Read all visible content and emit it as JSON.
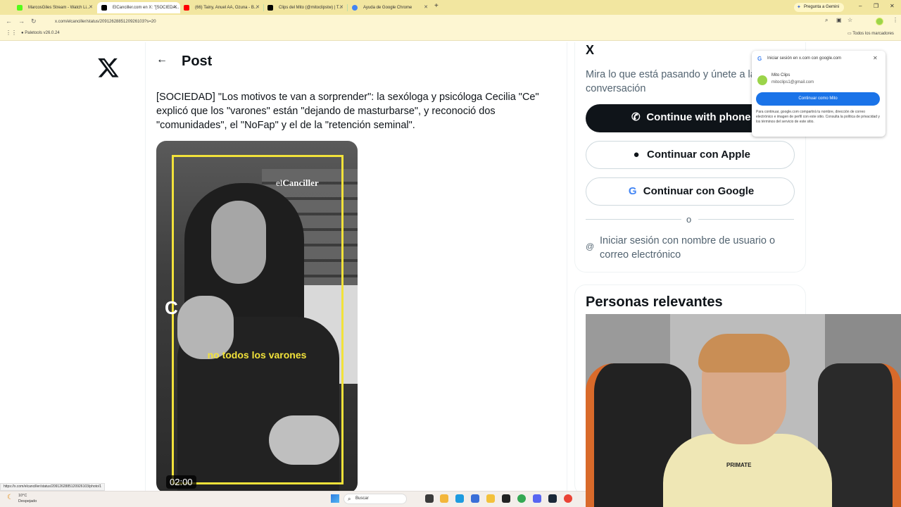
{
  "browser": {
    "tabs": [
      {
        "title": "MarcosGiles Stream - Watch Li...",
        "color": "#53fc18"
      },
      {
        "title": "ElCanciller.com en X: \"[SOCIEDA...",
        "color": "#000000",
        "active": true
      },
      {
        "title": "(66) Tainy, Anuel AA, Ozuna - B...",
        "color": "#ff0000"
      },
      {
        "title": "Clips del Mito (@mitoclipstw) | T...",
        "color": "#000000"
      },
      {
        "title": "Ayuda de Google Chrome",
        "color": "#4285f4"
      }
    ],
    "new_tab": "+",
    "gemini": "Pregunta a Gemini",
    "window_controls": [
      "–",
      "❐",
      "✕"
    ],
    "nav": {
      "back": "←",
      "forward": "→",
      "reload": "↻"
    },
    "url": "x.com/elcanciller/status/2091262885120926103?s=20",
    "bookmarks": [
      {
        "label": "Paletools v26.0.24"
      }
    ],
    "bookmarks_right": "Todos los marcadores",
    "status_url": "https://x.com/elcanciller/status/2091262885120926103/photo/1"
  },
  "x_page": {
    "logo": "X",
    "back_arrow": "←",
    "header": "Post",
    "post_text": "[SOCIEDAD] \"Los motivos te van a sorprender\": la sexóloga y psicóloga Cecilia \"Ce\" explicó que los \"varones\" están \"dejando de masturbarse\", y reconoció dos \"comunidades\", el \"NoFap\" y el de la \"retención seminal\".",
    "video": {
      "brand_prefix": "el",
      "brand_name": "Canciller",
      "overlay_letter": "C",
      "caption": "no todos los varones",
      "duration": "02:00",
      "frame_color": "#f2e23a"
    }
  },
  "sidebar": {
    "logo": "X",
    "subtitle": "Mira lo que está pasando y únete a la conversación",
    "phone_btn": "Continue with phone",
    "apple_btn": "Continuar con Apple",
    "google_btn": "Continuar con Google",
    "or": "o",
    "login_user": "Iniciar sesión con nombre de usuario o correo electrónico",
    "relevant_title": "Personas relevantes"
  },
  "google_popup": {
    "title": "Iniciar sesión en x.com con google.com",
    "name": "Mito Clips",
    "email": "mitoclips1@gmail.com",
    "button": "Continuar como Mito",
    "legal": "Para continuar, google.com compartirá tu nombre, dirección de correo electrónico e imagen de perfil con este sitio. Consulta la política de privacidad y los términos del servicio de este sitio."
  },
  "webcam": {
    "shirt_text": "PRIMATE"
  },
  "taskbar": {
    "temp": "10°C",
    "weather": "Despejado",
    "search": "Buscar",
    "apps": [
      {
        "name": "files-icon",
        "color": "#f3b63b"
      },
      {
        "name": "edge-icon",
        "color": "#1e9be0"
      },
      {
        "name": "store-icon",
        "color": "#3b6fd8"
      },
      {
        "name": "chrome-icon",
        "color": "#34a853"
      },
      {
        "name": "discord-icon",
        "color": "#5865f2"
      },
      {
        "name": "steam-icon",
        "color": "#1b2838"
      },
      {
        "name": "chrome-icon-2",
        "color": "#ea4335"
      }
    ]
  }
}
